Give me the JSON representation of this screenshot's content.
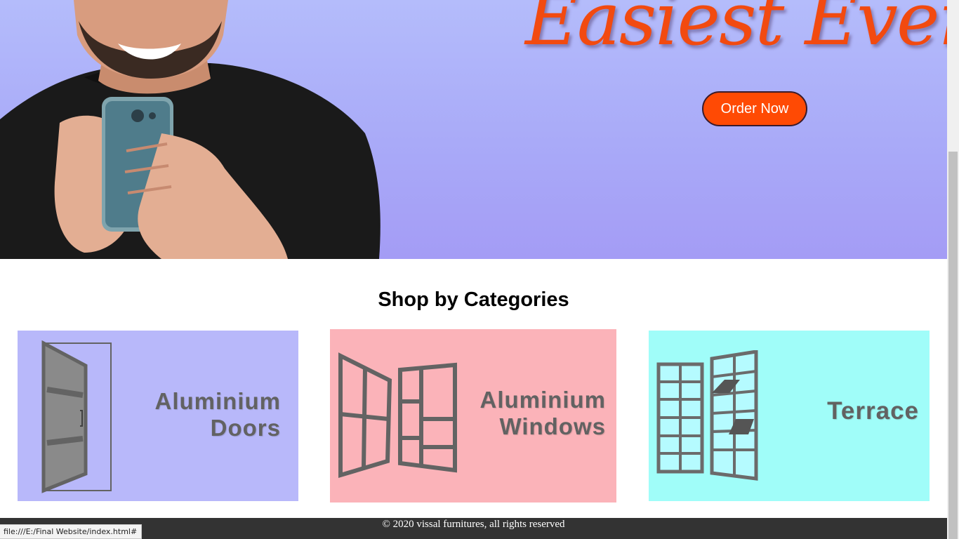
{
  "hero": {
    "title": "Easiest Ever",
    "cta_label": "Order Now"
  },
  "categories": {
    "heading": "Shop by Categories",
    "items": [
      {
        "line1": "Aluminium",
        "line2": "Doors",
        "color": "#b8b8fa"
      },
      {
        "line1": "Aluminium",
        "line2": "Windows",
        "color": "#fbb3b9"
      },
      {
        "line1": "Terrace",
        "line2": "",
        "color": "#a0fdf9"
      }
    ]
  },
  "footer": {
    "text": "© 2020 vissal furnitures, all rights reserved"
  },
  "status_bar": {
    "url": "file:///E:/Final Website/index.html#"
  },
  "colors": {
    "accent": "#ff4a04",
    "hero_bg": "#aaaaf8",
    "footer_bg": "#333333"
  }
}
